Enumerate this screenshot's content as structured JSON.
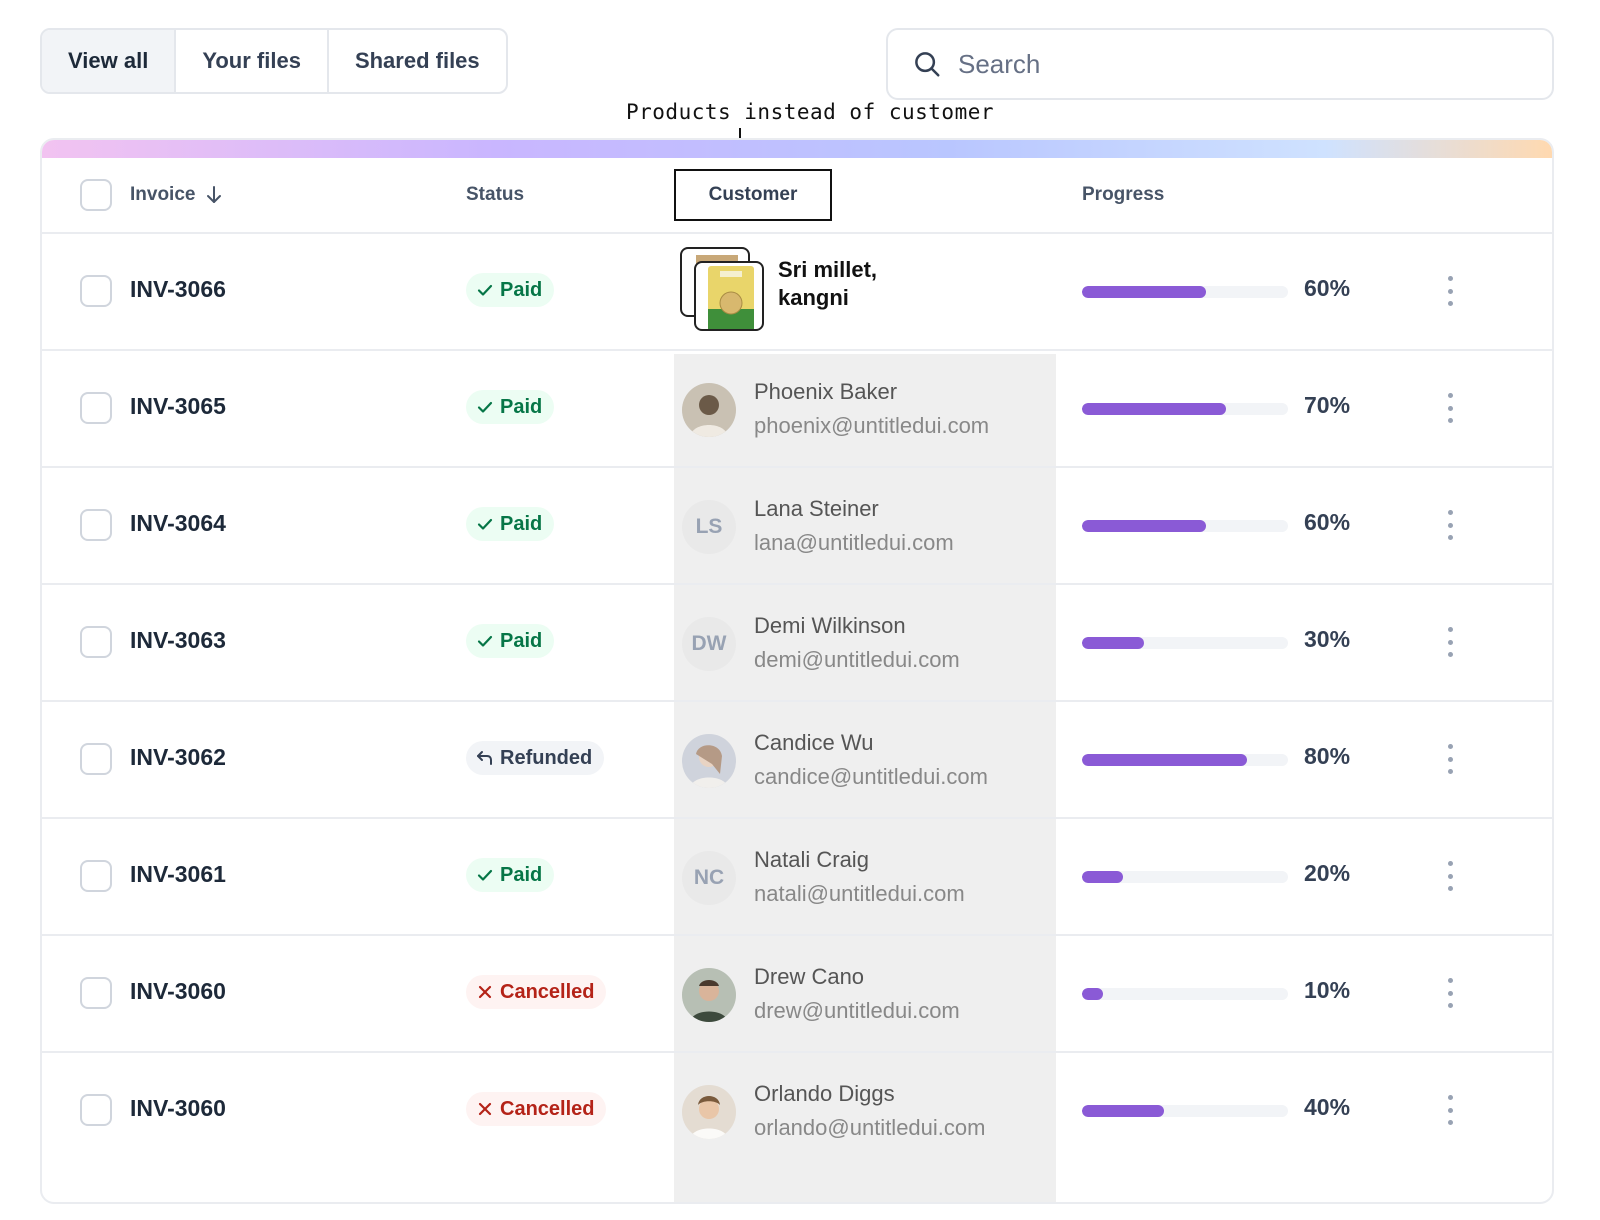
{
  "toolbar": {
    "tabs": [
      {
        "label": "View all",
        "active": true
      },
      {
        "label": "Your files",
        "active": false
      },
      {
        "label": "Shared files",
        "active": false
      }
    ],
    "search_placeholder": "Search"
  },
  "annotation": {
    "note": "Products instead of customer"
  },
  "table": {
    "headers": {
      "invoice": "Invoice",
      "status": "Status",
      "customer": "Customer",
      "progress": "Progress"
    },
    "rows": [
      {
        "invoice": "INV-3066",
        "status": "Paid",
        "status_type": "paid",
        "product": "Sri millet, kangni",
        "progress_label": "60%",
        "progress": 0.6
      },
      {
        "invoice": "INV-3065",
        "status": "Paid",
        "status_type": "paid",
        "name": "Phoenix Baker",
        "email": "phoenix@untitledui.com",
        "avatar": "photo",
        "progress_label": "70%",
        "progress": 0.7
      },
      {
        "invoice": "INV-3064",
        "status": "Paid",
        "status_type": "paid",
        "name": "Lana Steiner",
        "email": "lana@untitledui.com",
        "avatar_initials": "LS",
        "progress_label": "60%",
        "progress": 0.6
      },
      {
        "invoice": "INV-3063",
        "status": "Paid",
        "status_type": "paid",
        "name": "Demi Wilkinson",
        "email": "demi@untitledui.com",
        "avatar_initials": "DW",
        "progress_label": "30%",
        "progress": 0.3
      },
      {
        "invoice": "INV-3062",
        "status": "Refunded",
        "status_type": "refunded",
        "name": "Candice Wu",
        "email": "candice@untitledui.com",
        "avatar": "photo",
        "progress_label": "80%",
        "progress": 0.8
      },
      {
        "invoice": "INV-3061",
        "status": "Paid",
        "status_type": "paid",
        "name": "Natali Craig",
        "email": "natali@untitledui.com",
        "avatar_initials": "NC",
        "progress_label": "20%",
        "progress": 0.2
      },
      {
        "invoice": "INV-3060",
        "status": "Cancelled",
        "status_type": "cancelled",
        "name": "Drew Cano",
        "email": "drew@untitledui.com",
        "avatar": "photo",
        "progress_label": "10%",
        "progress": 0.1
      },
      {
        "invoice": "INV-3060",
        "status": "Cancelled",
        "status_type": "cancelled",
        "name": "Orlando Diggs",
        "email": "orlando@untitledui.com",
        "avatar": "photo",
        "progress_label": "40%",
        "progress": 0.4
      }
    ]
  },
  "colors": {
    "progress_fill": "#8a5ad6",
    "paid": "#067647",
    "cancelled": "#b42318"
  },
  "icons": {
    "search": "search-icon",
    "sort": "arrow-down-icon",
    "paid": "check-icon",
    "refunded": "undo-arrow-icon",
    "cancelled": "x-icon",
    "row_menu": "more-vertical-icon"
  }
}
